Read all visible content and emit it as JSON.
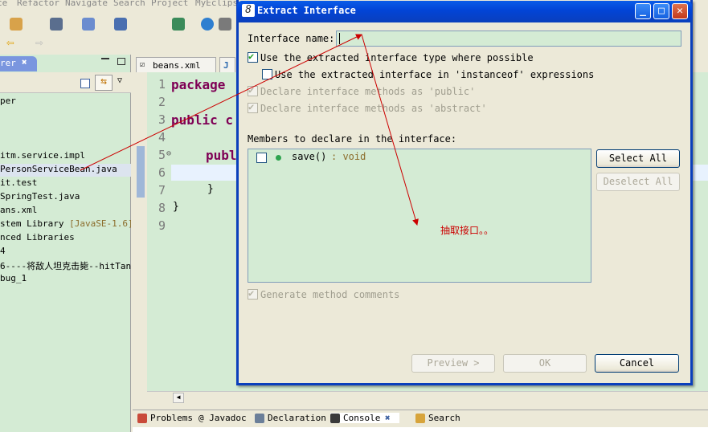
{
  "menubar": [
    "ce",
    "Refactor",
    "Navigate",
    "Search",
    "Project",
    "MyEclipse"
  ],
  "left_panel": {
    "tab_label": "rer",
    "tree": [
      {
        "text": "per",
        "suffix": ""
      },
      {
        "text": "",
        "suffix": ""
      },
      {
        "text": "",
        "suffix": ""
      },
      {
        "text": "",
        "suffix": ""
      },
      {
        "text": "itm.service.impl",
        "suffix": ""
      },
      {
        "text": "PersonServiceBean.java",
        "suffix": ""
      },
      {
        "text": "it.test",
        "suffix": ""
      },
      {
        "text": "SpringTest.java",
        "suffix": ""
      },
      {
        "text": "ans.xml",
        "suffix": ""
      },
      {
        "text": "stem Library ",
        "suffix": "[JavaSE-1.6]"
      },
      {
        "text": "nced Libraries",
        "suffix": ""
      },
      {
        "text": "4",
        "suffix": ""
      },
      {
        "text": "6----将敌人坦克击毙--hitTan",
        "suffix": ""
      },
      {
        "text": "bug_1",
        "suffix": ""
      }
    ]
  },
  "editor": {
    "tabs": [
      "beans.xml",
      ""
    ],
    "line_numbers": [
      "1",
      "2",
      "3",
      "4",
      "5",
      "6",
      "7",
      "8",
      "9"
    ],
    "lines": [
      "package",
      "",
      "public c",
      "",
      "publ",
      "",
      "}",
      "}",
      ""
    ]
  },
  "console_tabs": [
    "Problems",
    "@ Javadoc",
    "Declaration",
    "Console",
    "Search"
  ],
  "dialog": {
    "title": "Extract Interface",
    "interface_name_label": "Interface name:",
    "interface_name_value": "",
    "options": [
      {
        "label": "Use the extracted interface type where possible",
        "checked": true,
        "enabled": true
      },
      {
        "label": "Use the extracted interface in 'instanceof' expressions",
        "checked": false,
        "enabled": true
      },
      {
        "label": "Declare interface methods as 'public'",
        "checked": true,
        "enabled": false
      },
      {
        "label": "Declare interface methods as 'abstract'",
        "checked": true,
        "enabled": false
      }
    ],
    "members_label": "Members to declare in the interface:",
    "members": [
      {
        "name": "save()",
        "type": ": void",
        "checked": false
      }
    ],
    "select_all": "Select All",
    "deselect_all": "Deselect All",
    "generate_comments": {
      "label": "Generate method comments",
      "checked": true,
      "enabled": false
    },
    "preview": "Preview >",
    "ok": "OK",
    "cancel": "Cancel"
  },
  "annotation": "抽取接口。。",
  "colors": {
    "title_bar": "#0a3fbc",
    "editor_bg": "#d4ebd4",
    "keyword": "#7f0055",
    "annotation": "#cc0000"
  }
}
